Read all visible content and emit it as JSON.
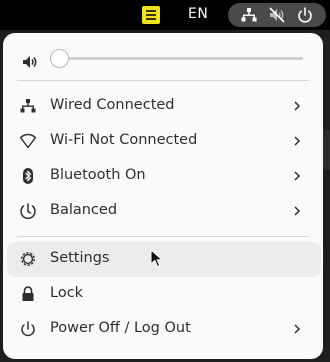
{
  "topbar": {
    "input_language": "EN"
  },
  "system_menu": {
    "volume": {
      "level": 0
    },
    "items": [
      {
        "label": "Wired Connected",
        "icon": "wired-network-icon",
        "has_submenu": true
      },
      {
        "label": "Wi-Fi Not Connected",
        "icon": "wifi-icon",
        "has_submenu": true
      },
      {
        "label": "Bluetooth On",
        "icon": "bluetooth-icon",
        "has_submenu": true
      },
      {
        "label": "Balanced",
        "icon": "power-profile-icon",
        "has_submenu": true
      }
    ],
    "actions": [
      {
        "label": "Settings",
        "icon": "gear-icon",
        "has_submenu": false,
        "hovered": true
      },
      {
        "label": "Lock",
        "icon": "lock-icon",
        "has_submenu": false
      },
      {
        "label": "Power Off / Log Out",
        "icon": "power-icon",
        "has_submenu": true
      }
    ]
  }
}
